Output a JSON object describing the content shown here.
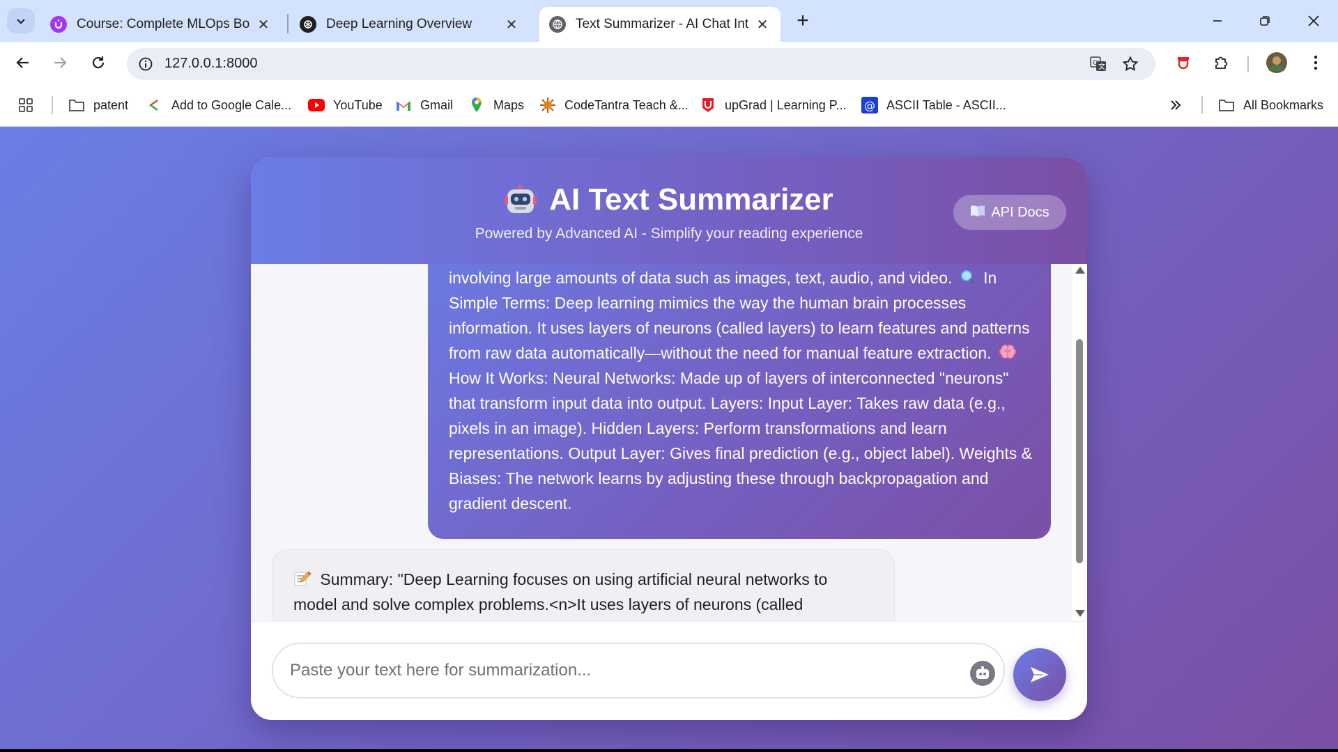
{
  "browser": {
    "tabs": [
      {
        "title": "Course: Complete MLOps Bootc",
        "active": false
      },
      {
        "title": "Deep Learning Overview",
        "active": false
      },
      {
        "title": "Text Summarizer - AI Chat Interf",
        "active": true
      }
    ],
    "url": "127.0.0.1:8000",
    "bookmarks": [
      {
        "label": "patent",
        "icon": "folder-icon"
      },
      {
        "label": "Add to Google Cale...",
        "icon": "google-calendar-icon"
      },
      {
        "label": "YouTube",
        "icon": "youtube-icon"
      },
      {
        "label": "Gmail",
        "icon": "gmail-icon"
      },
      {
        "label": "Maps",
        "icon": "maps-icon"
      },
      {
        "label": "CodeTantra Teach &...",
        "icon": "codetantra-icon"
      },
      {
        "label": "upGrad | Learning P...",
        "icon": "upgrad-icon"
      },
      {
        "label": "ASCII Table - ASCII...",
        "icon": "ascii-icon"
      }
    ],
    "all_bookmarks_label": "All Bookmarks"
  },
  "app": {
    "title": "AI Text Summarizer",
    "subtitle": "Powered by Advanced AI - Simplify your reading experience",
    "api_docs_label": "API Docs",
    "title_icon": "robot-icon",
    "api_docs_icon": "book-icon"
  },
  "chat": {
    "user_message": {
      "part1": "involving large amounts of data such as images, text, audio, and video.",
      "part2": "In Simple Terms: Deep learning mimics the way the human brain processes information. It uses layers of neurons (called layers) to learn features and patterns from raw data automatically—without the need for manual feature extraction.",
      "part3": "How It Works: Neural Networks: Made up of layers of interconnected \"neurons\" that transform input data into output. Layers: Input Layer: Takes raw data (e.g., pixels in an image). Hidden Layers: Perform transformations and learn representations. Output Layer: Gives final prediction (e.g., object label). Weights & Biases: The network learns by adjusting these through backpropagation and gradient descent."
    },
    "bot_message": {
      "icon": "memo-icon",
      "text": "Summary: \"Deep Learning focuses on using artificial neural networks to model and solve complex problems.<n>It uses layers of neurons (called"
    }
  },
  "composer": {
    "placeholder": "Paste your text here for summarization..."
  },
  "colors": {
    "accent_start": "#6a7de6",
    "accent_end": "#7a4fa6"
  }
}
